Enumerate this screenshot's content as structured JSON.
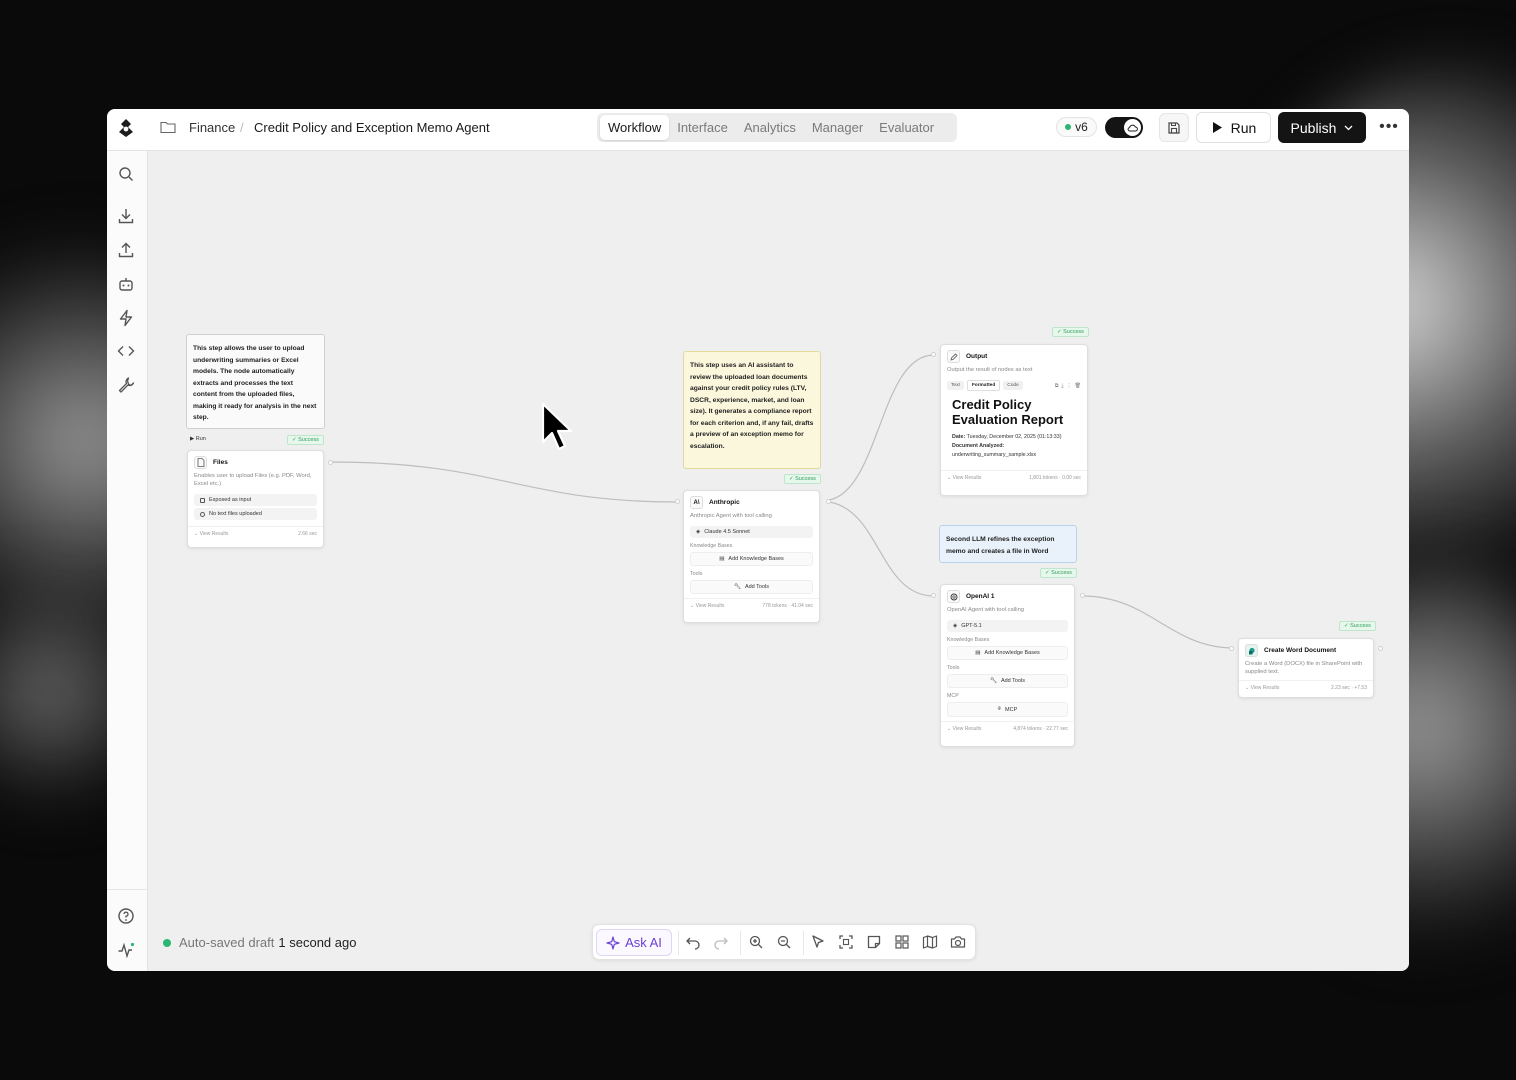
{
  "header": {
    "breadcrumb_folder": "Finance",
    "breadcrumb_title": "Credit Policy and Exception Memo Agent",
    "tabs": [
      {
        "label": "Workflow",
        "active": true
      },
      {
        "label": "Interface",
        "active": false
      },
      {
        "label": "Analytics",
        "active": false
      },
      {
        "label": "Manager",
        "active": false
      },
      {
        "label": "Evaluator",
        "active": false
      }
    ],
    "version": "v6",
    "run_label": "Run",
    "publish_label": "Publish"
  },
  "sidebar": {
    "icons": [
      "search-icon",
      "download-icon",
      "upload-icon",
      "bot-icon",
      "bolt-icon",
      "code-icon",
      "wrench-icon",
      "help-icon",
      "activity-icon"
    ]
  },
  "notes": {
    "files_note": "This step allows the user to upload underwriting summaries or Excel models. The node automatically extracts and processes the text content from the uploaded files, making it ready for analysis in the next step.",
    "anthropic_note": "This step uses an AI assistant to review the uploaded loan documents against your credit policy rules (LTV, DSCR, experience, market, and loan size). It generates a compliance report for each criterion and, if any fail, drafts a preview of an exception memo for escalation.",
    "openai_note": "Second LLM refines the exception memo and creates a file in Word"
  },
  "nodes": {
    "files": {
      "run_label": "Run",
      "status": "✓ Success",
      "title": "Files",
      "desc": "Enables user to upload Files (e.g. PDF, Word, Excel etc.)",
      "row1": "Exposed as input",
      "row2": "No text files uploaded",
      "foot_left": "View Results",
      "foot_right": "2.66 sec"
    },
    "anthropic": {
      "status": "✓ Success",
      "title": "Anthropic",
      "desc": "Anthropic Agent with tool calling",
      "model": "Claude 4.5 Sonnet",
      "kb_label": "Knowledge Bases",
      "kb_button": "Add Knowledge Bases",
      "tools_label": "Tools",
      "tools_button": "Add Tools",
      "foot_left": "View Results",
      "foot_right": "778 tokens · 41.04 sec"
    },
    "output": {
      "status": "✓ Success",
      "title": "Output",
      "desc": "Output the result of nodes as text",
      "tabs": [
        "Text",
        "Formatted",
        "Code"
      ],
      "report_title": "Credit Policy Evaluation Report",
      "date_label": "Date:",
      "date_value": "Tuesday, December 02, 2025 (01:13:33)",
      "doc_label": "Document Analyzed:",
      "doc_value": "underwriting_summary_sample.xlsx",
      "foot_left": "View Results",
      "foot_right": "1,801 tokens · 0.00 sec"
    },
    "openai": {
      "status": "✓ Success",
      "title": "OpenAI 1",
      "desc": "OpenAI Agent with tool calling",
      "model": "GPT-5.1",
      "kb_label": "Knowledge Bases",
      "kb_button": "Add Knowledge Bases",
      "tools_label": "Tools",
      "tools_button": "Add Tools",
      "mcp_label": "MCP",
      "mcp_button": "MCP",
      "foot_left": "View Results",
      "foot_right": "4,874 tokens · 22.77 sec"
    },
    "word": {
      "status": "✓ Success",
      "title": "Create Word Document",
      "desc": "Create a Word (DOCX) file in SharePoint with supplied text.",
      "foot_left": "View Results",
      "foot_right": "2.23 sec · +7.53"
    }
  },
  "status_bar": {
    "prefix": "Auto-saved draft",
    "time": "1 second ago"
  },
  "toolbar": {
    "ask_ai": "Ask AI"
  },
  "colors": {
    "accent_purple": "#6b3fd4",
    "success_green": "#2bb673",
    "publish_bg": "#141414"
  }
}
